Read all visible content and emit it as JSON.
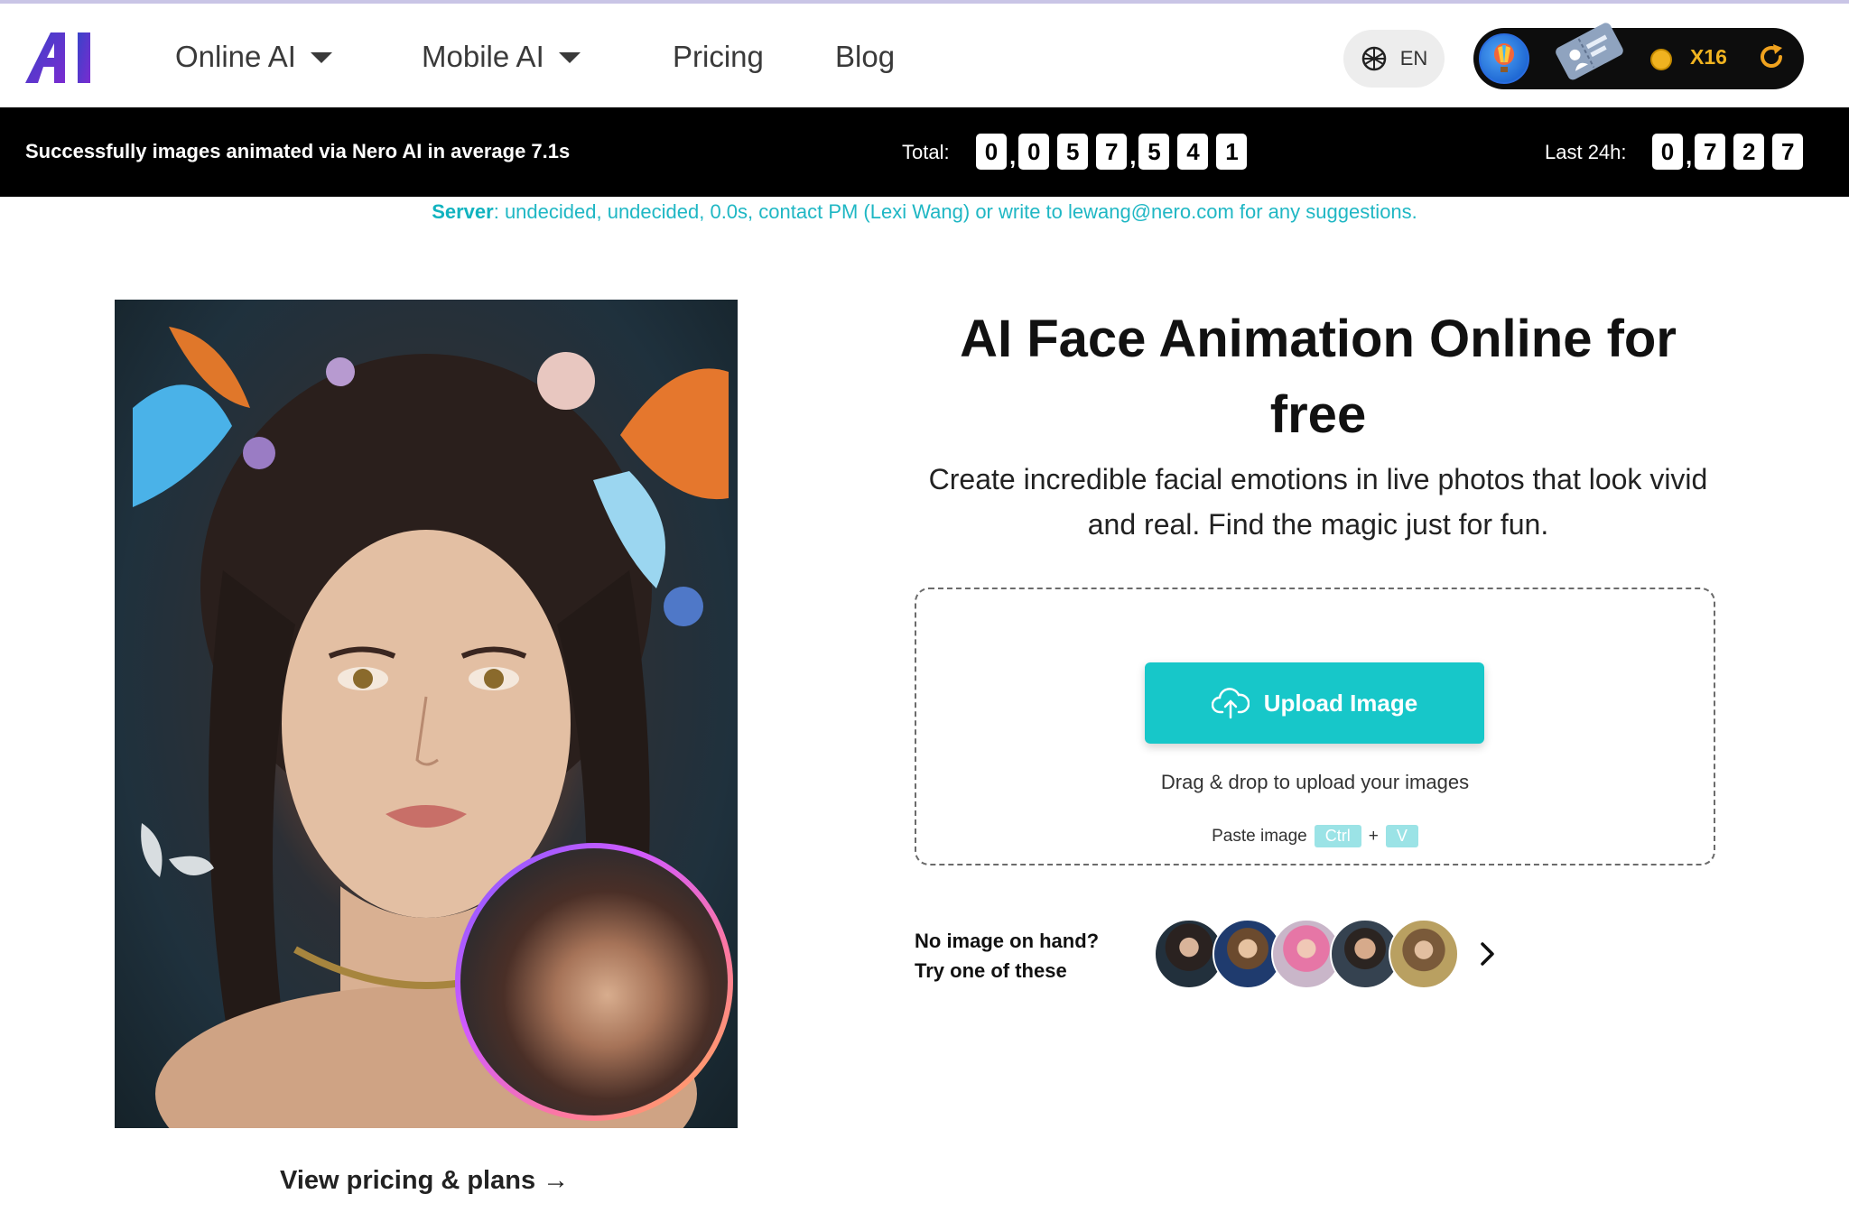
{
  "nav": {
    "items": [
      {
        "label": "Online AI",
        "dropdown": true
      },
      {
        "label": "Mobile AI",
        "dropdown": true
      },
      {
        "label": "Pricing",
        "dropdown": false
      },
      {
        "label": "Blog",
        "dropdown": false
      }
    ],
    "language": "EN",
    "account": {
      "coin_count": "X16",
      "icons": [
        "balloon-avatar-icon",
        "ticket-icon",
        "coin-icon",
        "refresh-icon"
      ]
    }
  },
  "stats": {
    "message": "Successfully images animated via Nero AI in average 7.1s",
    "total_label": "Total:",
    "total_digits": [
      "0",
      ",",
      "0",
      "5",
      "7",
      ",",
      "5",
      "4",
      "1"
    ],
    "last24_label": "Last 24h:",
    "last24_digits": [
      "0",
      ",",
      "7",
      "2",
      "7"
    ]
  },
  "server": {
    "label": "Server",
    "text": ": undecided, undecided, 0.0s, contact PM (Lexi Wang) or write to lewang@nero.com for any suggestions."
  },
  "hero": {
    "view_pricing": "View pricing & plans →"
  },
  "main": {
    "title": "AI Face Animation Online for free",
    "subtitle": "Create incredible facial emotions in live photos that look vivid and real. Find the magic just for fun.",
    "upload_label": "Upload Image",
    "drag_text": "Drag & drop to upload your images",
    "paste_label": "Paste image",
    "paste_key1": "Ctrl",
    "paste_plus": "+",
    "paste_key2": "V",
    "try_line1": "No image on hand?",
    "try_line2": "Try one of these"
  },
  "colors": {
    "accent": "#17c7c9",
    "stats_bg": "#000000",
    "coin": "#f0b320",
    "server_text": "#1fb7c4"
  }
}
